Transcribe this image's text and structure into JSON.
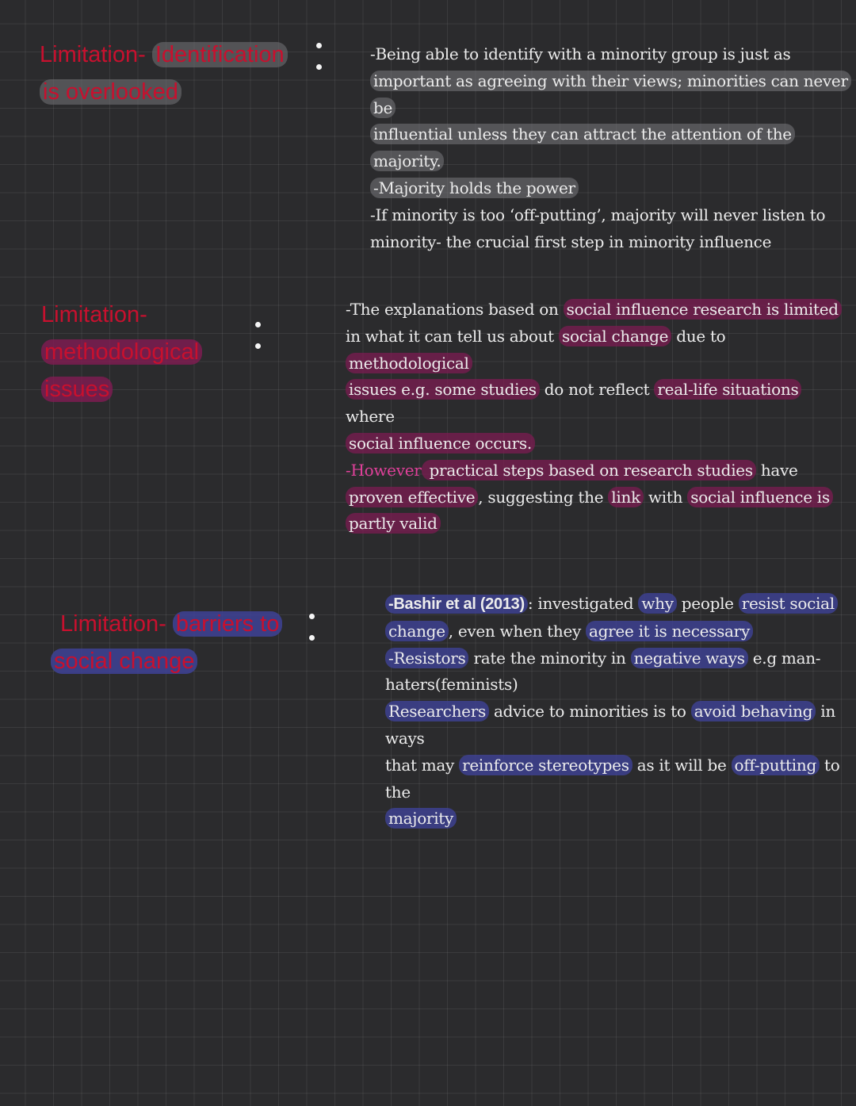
{
  "sections": [
    {
      "heading": {
        "part1": "Limitation- ",
        "part2": "Identification",
        "part3": "is overlooked"
      },
      "lines": {
        "l1a": "-Being able to identify with a minority group is just as",
        "l2a": "important as agreeing with their views; minorities can never be",
        "l3a": "influential unless they can attract the attention of the majority.",
        "l4a": "-Majority holds the power",
        "l5a": "-If minority is too ‘off-putting’, majority will never listen to",
        "l6a": "minority- the crucial first step in minority influence"
      }
    },
    {
      "heading": {
        "part1": "Limitation-",
        "part2": "methodological",
        "part3": "issues"
      },
      "lines": {
        "a1": "-The explanations based on ",
        "a2": "social influence research is limited",
        "b1": "in what it can tell us about ",
        "b2": "social change",
        "b3": " due to ",
        "b4": "methodological",
        "c1": "issues e.g. some studies",
        "c2": " do not reflect ",
        "c3": "real-life situations",
        "c4": " where",
        "d1": "social influence occurs.",
        "e1": "-However",
        "e2": " practical steps based on research studies",
        "e3": " have",
        "f1": "proven effective",
        "f2": ", suggesting the ",
        "f3": "link",
        "f4": " with ",
        "f5": "social influence is",
        "g1": "partly valid"
      }
    },
    {
      "heading": {
        "part1": "Limitation- ",
        "part2": "barriers to",
        "part3": "social change"
      },
      "lines": {
        "a1": "-Bashir et al (2013)",
        "a2": ": investigated ",
        "a3": "why",
        "a4": " people ",
        "a5": "resist social",
        "b1": "change",
        "b2": ", even when they ",
        "b3": "agree it is necessary",
        "c1": "-Resistors",
        "c2": " rate the minority in ",
        "c3": "negative ways",
        "c4": " e.g man-",
        "d1": "haters(feminists)",
        "e1": "Researchers",
        "e2": " advice to minorities is to ",
        "e3": "avoid behaving",
        "e4": " in ways",
        "f1": "that may ",
        "f2": "reinforce stereotypes",
        "f3": " as it will be ",
        "f4": "off-putting",
        "f5": " to the",
        "g1": "majority"
      }
    }
  ],
  "colors": {
    "background": "#2b2b2d",
    "heading_red": "#c8102e",
    "highlight_grey": "#5e5e62",
    "highlight_pink": "#781c50",
    "highlight_blue": "#3e4296",
    "accent_pink_text": "#e0409a"
  }
}
